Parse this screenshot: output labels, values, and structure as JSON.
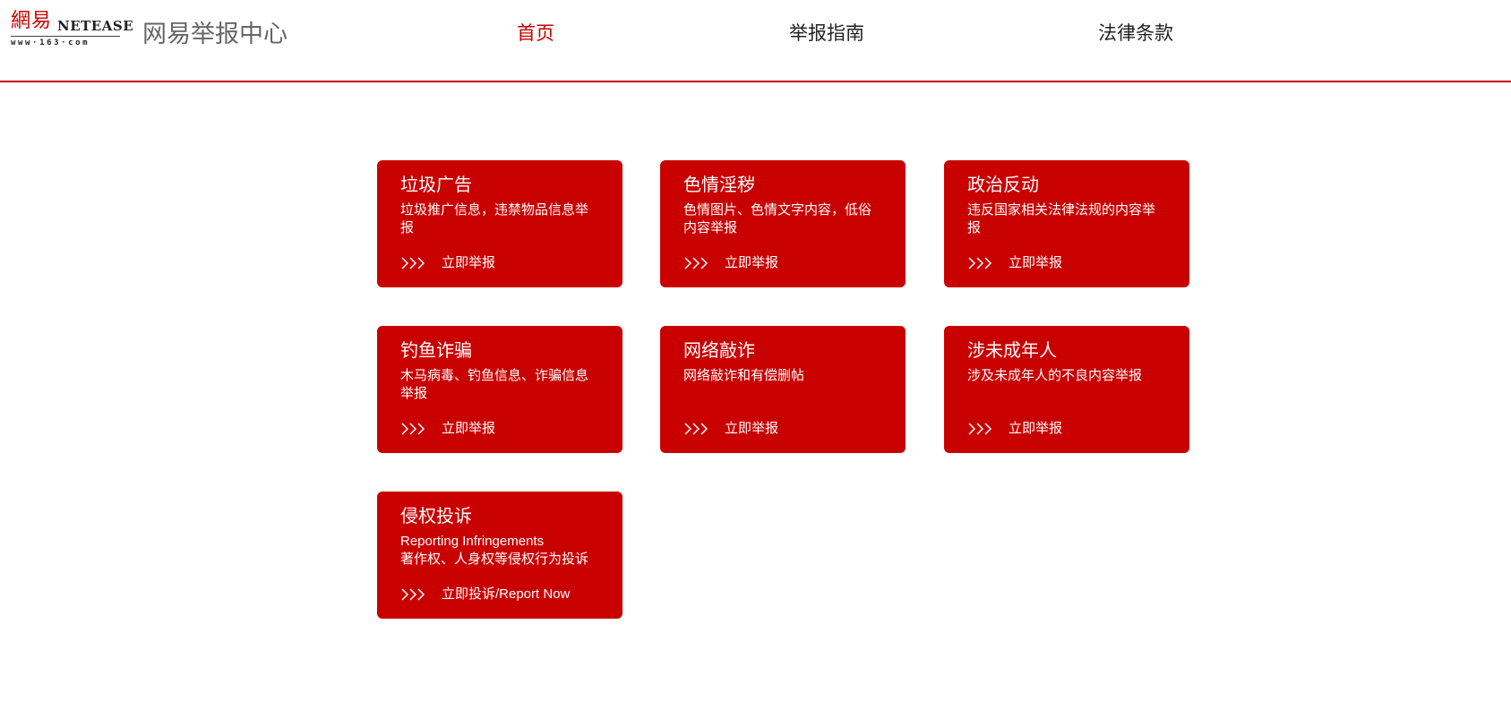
{
  "brand": {
    "logo_cn": "網易",
    "logo_en": "NETEASE",
    "logo_url": "www·163·com",
    "site_title": "网易举报中心"
  },
  "nav": {
    "items": [
      {
        "label": "首页",
        "active": true
      },
      {
        "label": "举报指南",
        "active": false
      },
      {
        "label": "法律条款",
        "active": false
      }
    ]
  },
  "colors": {
    "accent": "#c90000",
    "card_text": "#ffffff"
  },
  "cards": [
    {
      "title": "垃圾广告",
      "desc": [
        "垃圾推广信息，违禁物品信息举",
        "报"
      ],
      "action": "立即举报",
      "icon": "triple-chevron-right-icon"
    },
    {
      "title": "色情淫秽",
      "desc": [
        "色情图片、色情文字内容，低俗",
        "内容举报"
      ],
      "action": "立即举报",
      "icon": "triple-chevron-right-icon"
    },
    {
      "title": "政治反动",
      "desc": [
        "违反国家相关法律法规的内容举",
        "报"
      ],
      "action": "立即举报",
      "icon": "triple-chevron-right-icon"
    },
    {
      "title": "钓鱼诈骗",
      "desc": [
        "木马病毒、钓鱼信息、诈骗信息",
        "举报"
      ],
      "action": "立即举报",
      "icon": "triple-chevron-right-icon"
    },
    {
      "title": "网络敲诈",
      "desc": [
        "网络敲诈和有偿删帖",
        ""
      ],
      "action": "立即举报",
      "icon": "triple-chevron-right-icon"
    },
    {
      "title": "涉未成年人",
      "desc": [
        "涉及未成年人的不良内容举报",
        ""
      ],
      "action": "立即举报",
      "icon": "triple-chevron-right-icon"
    },
    {
      "title": "侵权投诉",
      "desc": [
        "Reporting Infringements",
        "著作权、人身权等侵权行为投诉"
      ],
      "action": "立即投诉/Report Now",
      "icon": "triple-chevron-right-icon"
    }
  ]
}
